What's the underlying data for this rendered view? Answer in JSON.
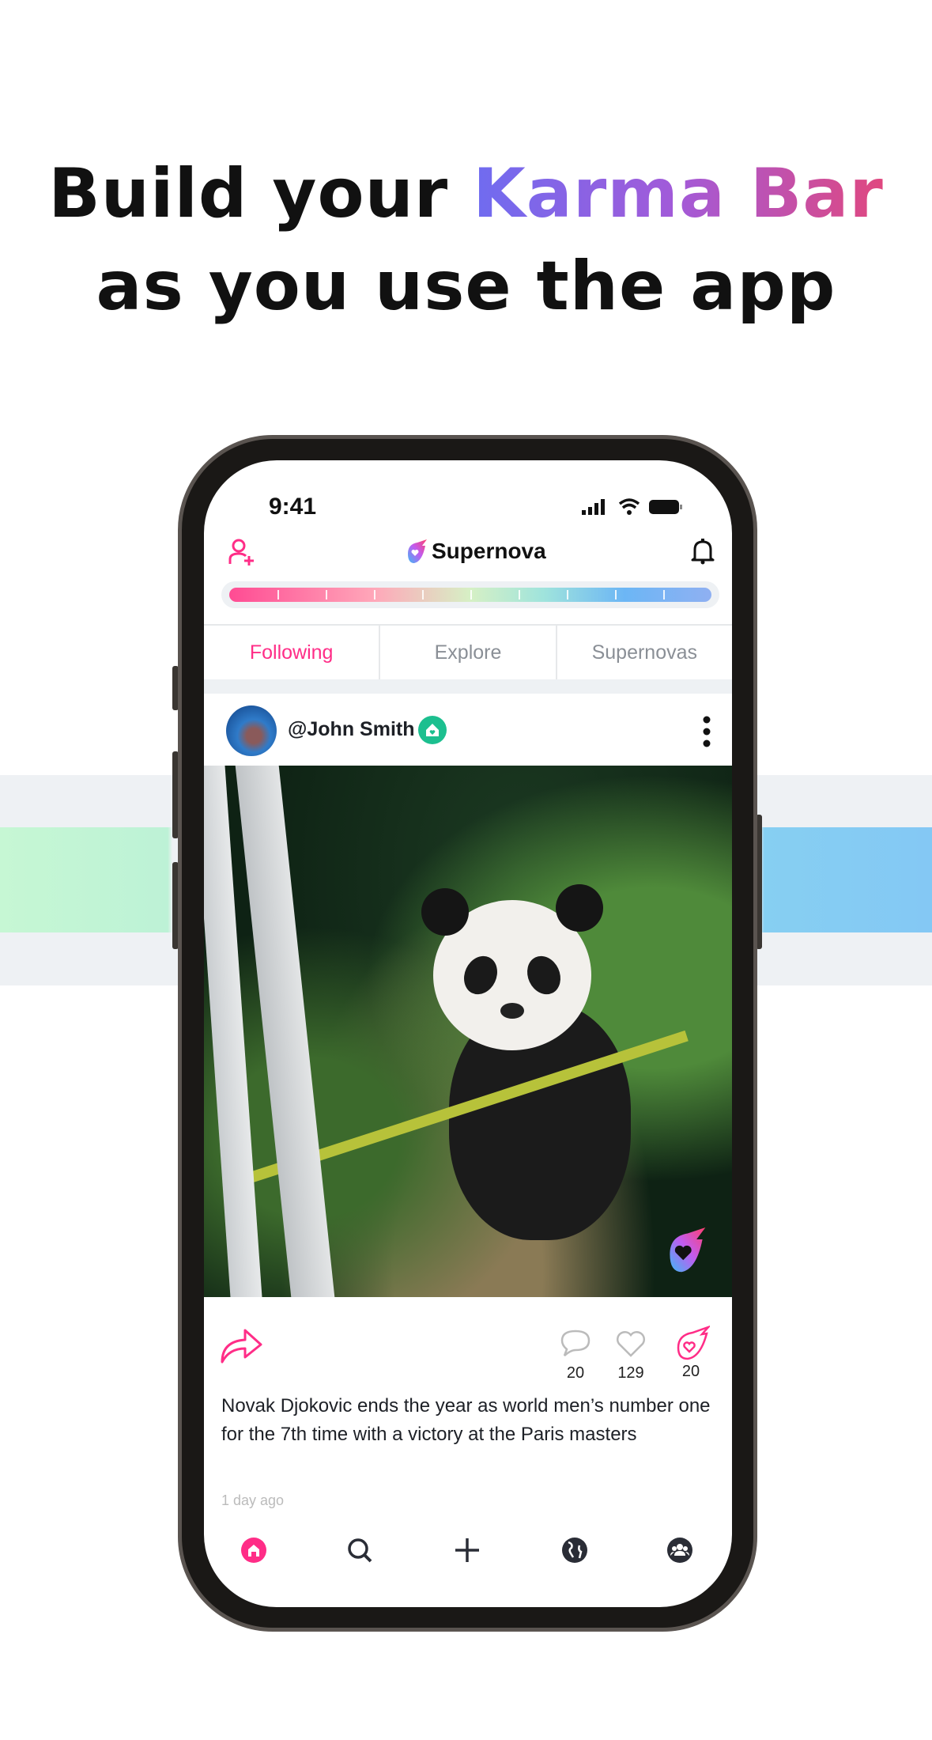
{
  "headline": {
    "line1_prefix": "Build your ",
    "line1_highlight": "Karma Bar",
    "line2": "as you use the app"
  },
  "status_bar": {
    "time": "9:41"
  },
  "app_header": {
    "title": "Supernova",
    "left_icon": "add-user-icon",
    "right_icon": "bell-icon"
  },
  "karma_bar": {
    "segments": 10,
    "gradient": [
      "#ff4b93",
      "#ffa7b9",
      "#d6f0c5",
      "#a0e4dc",
      "#6cb6f5",
      "#8fb0f2"
    ]
  },
  "tabs": [
    {
      "label": "Following",
      "active": true
    },
    {
      "label": "Explore",
      "active": false
    },
    {
      "label": "Supernovas",
      "active": false
    }
  ],
  "post": {
    "username": "@John Smith",
    "caption": "Novak Djokovic ends the year as world men’s number one for the 7th time with a victory at the Paris masters",
    "timestamp": "1 day ago",
    "comments": "20",
    "likes": "129",
    "supernovas": "20"
  },
  "bottom_nav": [
    "home-icon",
    "search-icon",
    "plus-icon",
    "globe-icon",
    "group-icon"
  ],
  "colors": {
    "accent": "#ff2d87",
    "badge": "#1cbf8f",
    "inactive_tab": "#8a8f96"
  }
}
